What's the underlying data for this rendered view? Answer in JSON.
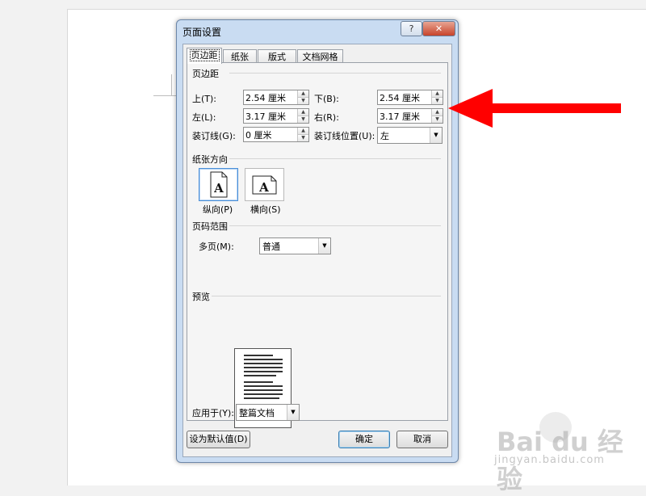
{
  "dialog": {
    "title": "页面设置",
    "help_glyph": "?",
    "close_glyph": "✕"
  },
  "tabs": [
    {
      "label": "页边距",
      "active": true
    },
    {
      "label": "纸张"
    },
    {
      "label": "版式"
    },
    {
      "label": "文档网格"
    }
  ],
  "margins": {
    "group_title": "页边距",
    "top_label": "上(T):",
    "top_value": "2.54 厘米",
    "bottom_label": "下(B):",
    "bottom_value": "2.54 厘米",
    "left_label": "左(L):",
    "left_value": "3.17 厘米",
    "right_label": "右(R):",
    "right_value": "3.17 厘米",
    "gutter_label": "装订线(G):",
    "gutter_value": "0 厘米",
    "gutter_pos_label": "装订线位置(U):",
    "gutter_pos_value": "左"
  },
  "orientation": {
    "group_title": "纸张方向",
    "portrait_label": "纵向(P)",
    "landscape_label": "横向(S)",
    "icon_glyph": "A",
    "selected": "portrait"
  },
  "pages": {
    "group_title": "页码范围",
    "multiple_label": "多页(M):",
    "multiple_value": "普通"
  },
  "preview": {
    "group_title": "预览"
  },
  "apply": {
    "label": "应用于(Y):",
    "value": "整篇文档"
  },
  "buttons": {
    "default": "设为默认值(D)",
    "ok": "确定",
    "cancel": "取消"
  },
  "icons": {
    "spin_up": "▲",
    "spin_down": "▼",
    "combo_arrow": "▼"
  },
  "watermark": {
    "main": "Bai du 经验",
    "sub": "jingyan.baidu.com"
  },
  "colors": {
    "annotation_arrow": "#ff0000",
    "dialog_frame": "#c9dcf2",
    "close_button": "#c7432a"
  }
}
